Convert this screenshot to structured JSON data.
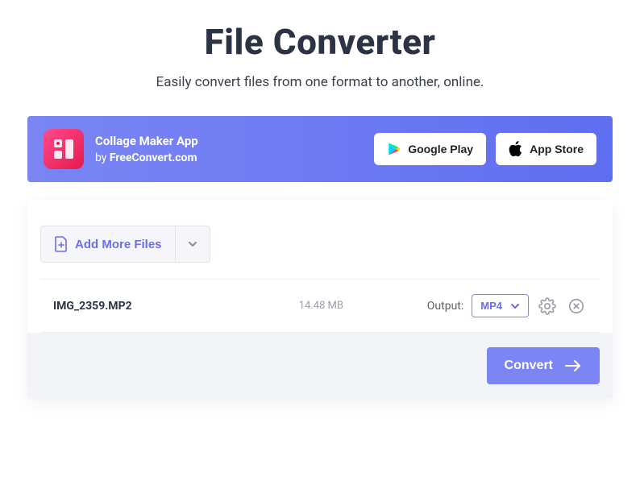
{
  "header": {
    "title": "File Converter",
    "subtitle": "Easily convert files from one format to another, online."
  },
  "promo": {
    "app_name": "Collage Maker App",
    "by_prefix": "by ",
    "by_brand": "FreeConvert.com",
    "google_play_label": "Google Play",
    "app_store_label": "App Store"
  },
  "toolbar": {
    "add_more_label": "Add More Files"
  },
  "file": {
    "name": "IMG_2359.MP2",
    "size": "14.48 MB",
    "output_label": "Output:",
    "output_format": "MP4"
  },
  "actions": {
    "convert_label": "Convert"
  }
}
